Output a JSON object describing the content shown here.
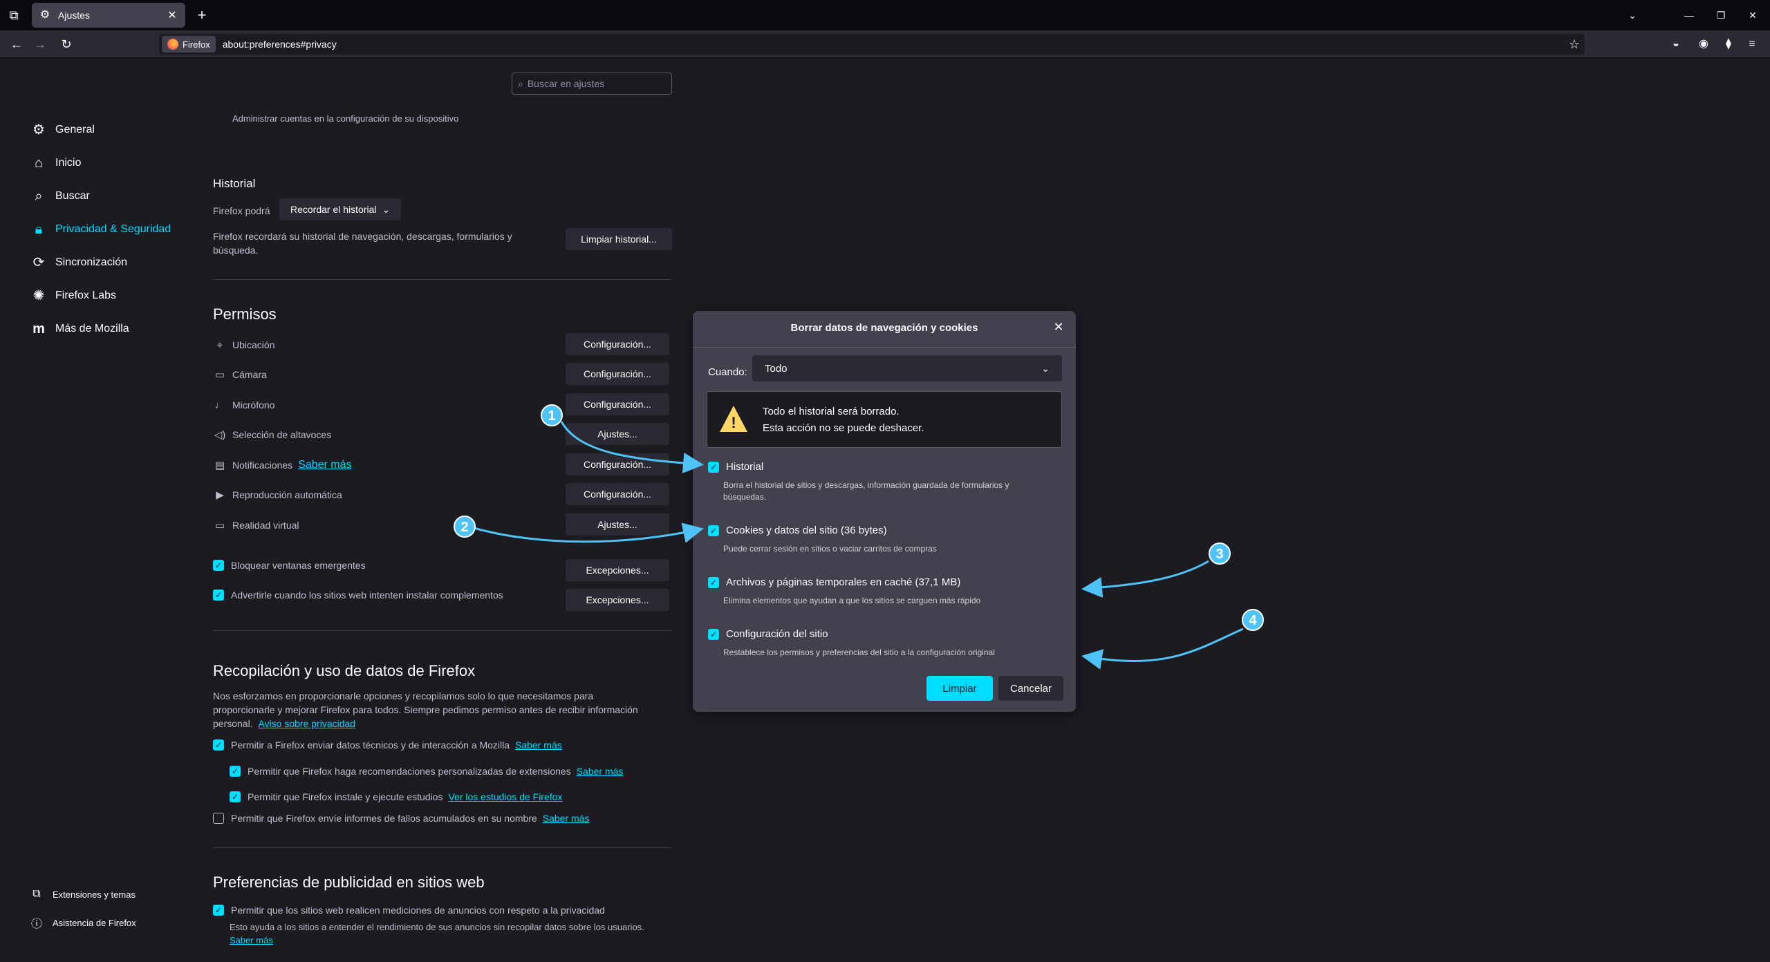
{
  "tab": {
    "title": "Ajustes"
  },
  "urlbar": {
    "identity": "Firefox",
    "url": "about:preferences#privacy"
  },
  "search": {
    "placeholder": "Buscar en ajustes"
  },
  "sidebar": {
    "items": [
      {
        "label": "General",
        "icon": "gear-icon"
      },
      {
        "label": "Inicio",
        "icon": "home-icon"
      },
      {
        "label": "Buscar",
        "icon": "search-icon"
      },
      {
        "label": "Privacidad & Seguridad",
        "icon": "lock-icon"
      },
      {
        "label": "Sincronización",
        "icon": "sync-icon"
      },
      {
        "label": "Firefox Labs",
        "icon": "labs-icon"
      },
      {
        "label": "Más de Mozilla",
        "icon": "mozilla-icon"
      }
    ],
    "bottom": [
      {
        "label": "Extensiones y temas",
        "icon": "puzzle-icon"
      },
      {
        "label": "Asistencia de Firefox",
        "icon": "help-icon"
      }
    ]
  },
  "main": {
    "accounts_note": "Administrar cuentas en la configuración de su dispositivo",
    "history": {
      "title": "Historial",
      "label": "Firefox podrá",
      "select": "Recordar el historial",
      "desc_1": "Firefox recordará su historial de navegación, descargas, formularios y",
      "desc_2": "búsqueda.",
      "clear_button": "Limpiar historial..."
    },
    "permissions": {
      "title": "Permisos",
      "rows": [
        {
          "label": "Ubicación",
          "button": "Configuración...",
          "icon": "location-icon"
        },
        {
          "label": "Cámara",
          "button": "Configuración...",
          "icon": "camera-icon"
        },
        {
          "label": "Micrófono",
          "button": "Configuración...",
          "icon": "microphone-icon"
        },
        {
          "label": "Selección de altavoces",
          "button": "Ajustes...",
          "icon": "speaker-icon"
        },
        {
          "label": "Notificaciones",
          "link": "Saber más",
          "button": "Configuración...",
          "icon": "notification-icon"
        },
        {
          "label": "Reproducción automática",
          "button": "Configuración...",
          "icon": "autoplay-icon"
        },
        {
          "label": "Realidad virtual",
          "button": "Ajustes...",
          "icon": "vr-icon"
        }
      ],
      "checks": [
        {
          "label": "Bloquear ventanas emergentes",
          "button": "Excepciones..."
        },
        {
          "label": "Advertirle cuando los sitios web intenten instalar complementos",
          "button": "Excepciones..."
        }
      ]
    },
    "data_collection": {
      "title": "Recopilación y uso de datos de Firefox",
      "desc_1": "Nos esforzamos en proporcionarle opciones y recopilamos solo lo que necesitamos para",
      "desc_2": "proporcionarle y mejorar Firefox para todos. Siempre pedimos permiso antes de recibir información",
      "desc_3": "personal.",
      "privacy_link": "Aviso sobre privacidad",
      "checks": [
        {
          "label": "Permitir a Firefox enviar datos técnicos y de interacción a Mozilla",
          "link": "Saber más",
          "checked": true
        },
        {
          "label": "Permitir que Firefox haga recomendaciones personalizadas de extensiones",
          "link": "Saber más",
          "checked": true
        },
        {
          "label": "Permitir que Firefox instale y ejecute estudios",
          "link": "Ver los estudios de Firefox",
          "checked": true
        },
        {
          "label": "Permitir que Firefox envíe informes de fallos acumulados en su nombre",
          "link": "Saber más",
          "checked": false
        }
      ]
    },
    "ads": {
      "title": "Preferencias de publicidad en sitios web",
      "check_label": "Permitir que los sitios web realicen mediciones de anuncios con respeto a la privacidad",
      "desc": "Esto ayuda a los sitios a entender el rendimiento de sus anuncios sin recopilar datos sobre los usuarios.",
      "link": "Saber más"
    }
  },
  "dialog": {
    "title": "Borrar datos de navegación y cookies",
    "when_label": "Cuando:",
    "when_value": "Todo",
    "warning_1": "Todo el historial será borrado.",
    "warning_2": "Esta acción no se puede deshacer.",
    "options": [
      {
        "title": "Historial",
        "desc_1": "Borra el historial de sitios y descargas, información guardada de formularios y",
        "desc_2": "búsquedas."
      },
      {
        "title": "Cookies y datos del sitio (36 bytes)",
        "desc_1": "Puede cerrar sesión en sitios o vaciar carritos de compras"
      },
      {
        "title": "Archivos y páginas temporales en caché (37,1 MB)",
        "desc_1": "Elimina elementos que ayudan a que los sitios se carguen más rápido"
      },
      {
        "title": "Configuración del sitio",
        "desc_1": "Restablece los permisos y preferencias del sitio a la configuración original"
      }
    ],
    "primary": "Limpiar",
    "secondary": "Cancelar"
  },
  "annotations": [
    "1",
    "2",
    "3",
    "4"
  ],
  "colors": {
    "accent": "#00ddff",
    "annotation": "#4fc3f7",
    "bg": "#1c1b22",
    "dialog": "#42414d",
    "warning": "#ffd567"
  }
}
